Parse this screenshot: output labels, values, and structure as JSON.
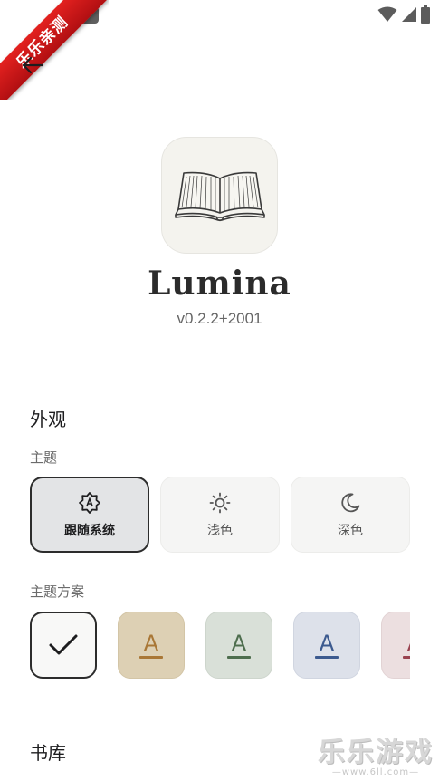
{
  "ribbon": {
    "text": "乐乐亲测"
  },
  "app": {
    "name": "Lumina",
    "version": "v0.2.2+2001"
  },
  "appearance": {
    "title": "外观",
    "theme_label": "主题",
    "theme_options": [
      {
        "label": "跟随系统",
        "icon": "auto-brightness-icon",
        "selected": true
      },
      {
        "label": "浅色",
        "icon": "sun-icon",
        "selected": false
      },
      {
        "label": "深色",
        "icon": "moon-icon",
        "selected": false
      }
    ],
    "scheme_label": "主题方案",
    "schemes": [
      {
        "glyph": "",
        "selected": true,
        "bg": "#f8f8f7"
      },
      {
        "glyph": "A",
        "color": "#a97736",
        "bg": "#ddd0b4"
      },
      {
        "glyph": "A",
        "color": "#4e6e4e",
        "bg": "#d9e0d8"
      },
      {
        "glyph": "A",
        "color": "#3c5a8f",
        "bg": "#dde1ea"
      },
      {
        "glyph": "A",
        "color": "#9a4350",
        "bg": "#ecdfe0"
      }
    ]
  },
  "library": {
    "title": "书库"
  },
  "watermark": {
    "text": "乐乐游戏",
    "url": "—www.6ll.com—"
  }
}
